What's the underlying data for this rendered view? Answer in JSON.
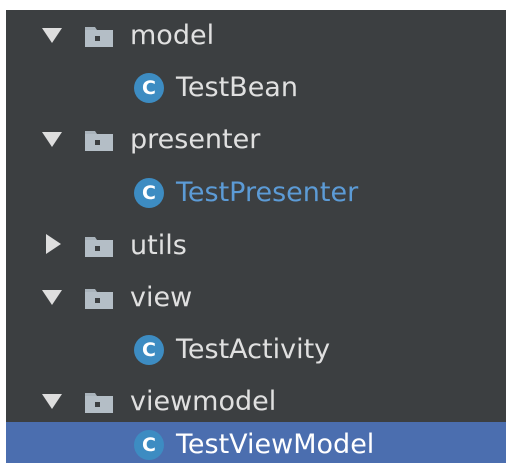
{
  "tree": {
    "items": [
      {
        "kind": "package",
        "label": "model",
        "expanded": true,
        "depth": 0
      },
      {
        "kind": "class",
        "label": "TestBean",
        "depth": 1
      },
      {
        "kind": "package",
        "label": "presenter",
        "expanded": true,
        "depth": 0
      },
      {
        "kind": "class",
        "label": "TestPresenter",
        "depth": 1,
        "color": "#5c9bd6"
      },
      {
        "kind": "package",
        "label": "utils",
        "expanded": false,
        "depth": 0
      },
      {
        "kind": "package",
        "label": "view",
        "expanded": true,
        "depth": 0
      },
      {
        "kind": "class",
        "label": "TestActivity",
        "depth": 1
      },
      {
        "kind": "package",
        "label": "viewmodel",
        "expanded": true,
        "depth": 0
      },
      {
        "kind": "class",
        "label": "TestViewModel",
        "depth": 1,
        "selected": true
      }
    ],
    "class_icon_glyph": "C"
  },
  "colors": {
    "panel_background": "#3c3f41",
    "selection": "#4b6eaf",
    "text": "#e0e0e0",
    "highlight_text": "#5c9bd6",
    "class_icon": "#3d8cc2",
    "folder": "#a9b3bb"
  },
  "icons": {
    "expanded": "triangle-down-icon",
    "collapsed": "triangle-right-icon",
    "package": "package-folder-icon",
    "class": "java-class-icon"
  }
}
